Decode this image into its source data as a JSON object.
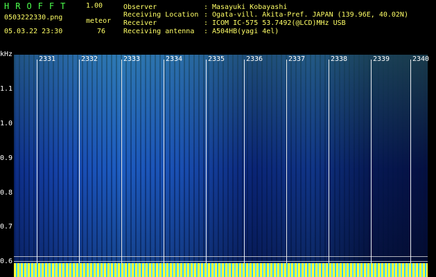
{
  "header": {
    "app_title": "HROFFT",
    "version": "1.00",
    "filename": "0503222330.png",
    "mode": "meteor",
    "datetime": "05.03.22 23:30",
    "count": "76"
  },
  "info": [
    {
      "key": "Observer",
      "value": "Masayuki Kobayashi"
    },
    {
      "key": "Receiving Location",
      "value": "Ogata-vill. Akita-Pref. JAPAN (139.96E, 40.02N)"
    },
    {
      "key": "Receiver",
      "value": "ICOM IC-575 53.7492(@LCD)MHz USB"
    },
    {
      "key": "Receiving antenna",
      "value": "A504HB(yagi 4el)"
    }
  ],
  "y_axis": {
    "label": "kHz",
    "ticks": [
      "1.1",
      "1.0",
      "0.9",
      "0.8",
      "0.7",
      "0.6"
    ]
  },
  "x_axis": {
    "ticks": [
      "2331",
      "2332",
      "2333",
      "2334",
      "2335",
      "2336",
      "2337",
      "2338",
      "2339",
      "2340"
    ]
  }
}
